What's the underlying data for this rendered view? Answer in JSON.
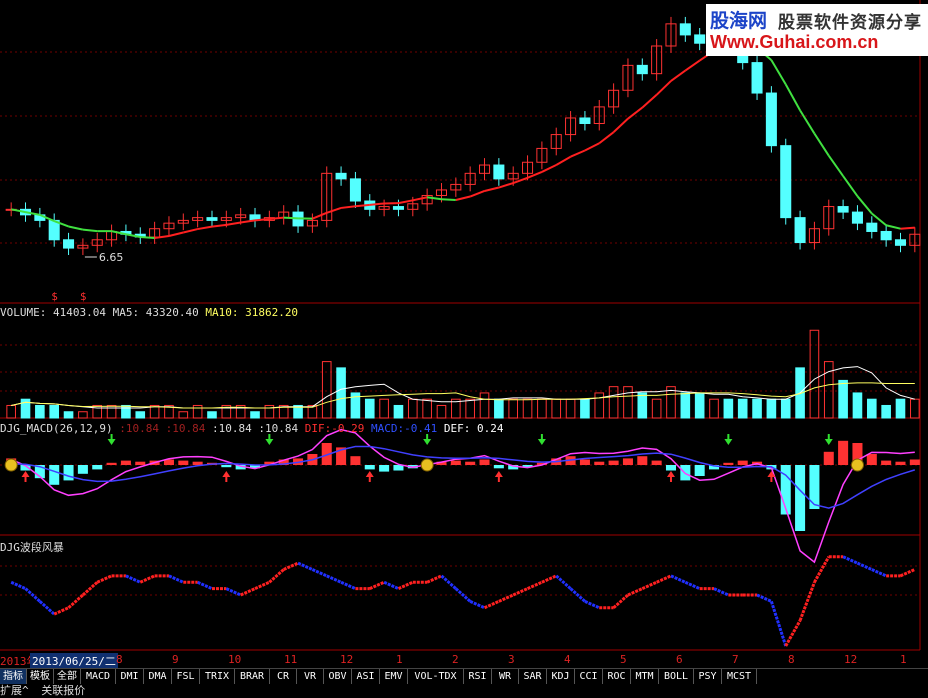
{
  "watermark": {
    "name": "股海网",
    "slogan": "股票软件资源分享",
    "url": "Www.Guhai.com.cn"
  },
  "panes": {
    "price": {
      "low_label": "6.65",
      "marker": "$"
    },
    "volume": {
      "label": "VOLUME:",
      "value": "41403.04",
      "ma5_label": "MA5:",
      "ma5": "43320.40",
      "ma10_label": "MA10:",
      "ma10": "31862.20"
    },
    "macd": {
      "label": "DJG_MACD(26,12,9)",
      "v1": ":10.84",
      "v2": ":10.84",
      "v3": ":10.84",
      "v4": ":10.84",
      "dif_label": "DIF:",
      "dif": "-0.29",
      "macd_label": "MACD:",
      "macd": "-0.41",
      "def_label": "DEF:",
      "def": "0.24"
    },
    "storm": {
      "label": "DJG波段风暴"
    }
  },
  "date_axis": {
    "start_year": "2013年",
    "cursor_date": "2013/06/25/二",
    "ticks": [
      "8",
      "9",
      "10",
      "11",
      "12",
      "1",
      "2",
      "3",
      "4",
      "5",
      "6",
      "7",
      "8",
      "12",
      "1"
    ]
  },
  "tabs": [
    "指标",
    "模板",
    "全部",
    "MACD",
    "DMI",
    "DMA",
    "FSL",
    "TRIX",
    "BRAR",
    "CR",
    "VR",
    "OBV",
    "ASI",
    "EMV",
    "VOL-TDX",
    "RSI",
    "WR",
    "SAR",
    "KDJ",
    "CCI",
    "ROC",
    "MTM",
    "BOLL",
    "PSY",
    "MCST"
  ],
  "status": {
    "expand": "扩展^",
    "quote": "关联报价"
  },
  "colors": {
    "up": "#ff3232",
    "down": "#54ffff",
    "ma_up": "#ff2020",
    "ma_down": "#40e040",
    "dif": "#ff40ff",
    "macd": "#4040ff",
    "grid": "#8b0000"
  },
  "chart_data": {
    "type": "candlestick",
    "subtype": "price with moving average, volume, MACD and oscillator sub-panes",
    "price": {
      "closes": [
        8.3,
        8.1,
        7.9,
        7.2,
        6.9,
        7.0,
        7.2,
        7.5,
        7.4,
        7.3,
        7.6,
        7.8,
        7.9,
        8.0,
        7.9,
        8.0,
        8.1,
        7.9,
        8.0,
        8.2,
        7.7,
        7.9,
        9.6,
        9.4,
        8.6,
        8.3,
        8.4,
        8.3,
        8.5,
        8.8,
        9.0,
        9.2,
        9.6,
        9.9,
        9.4,
        9.6,
        10.0,
        10.5,
        11.0,
        11.6,
        11.4,
        12.0,
        12.6,
        13.5,
        13.2,
        14.2,
        15.0,
        14.6,
        14.3,
        14.8,
        14.1,
        13.6,
        12.5,
        10.6,
        8.0,
        7.1,
        7.6,
        8.4,
        8.2,
        7.8,
        7.5,
        7.2,
        7.0,
        7.4
      ],
      "ma_up_segments": "red while rising",
      "ma_down_segments": "green while falling",
      "annotated_low": 6.65
    },
    "volume": {
      "values": [
        2,
        3,
        2,
        2,
        1,
        1,
        2,
        2,
        2,
        1,
        2,
        2,
        1,
        2,
        1,
        2,
        2,
        1,
        2,
        2,
        2,
        2,
        9,
        8,
        4,
        3,
        3,
        2,
        3,
        3,
        2,
        3,
        3,
        4,
        3,
        3,
        3,
        3,
        3,
        3,
        3,
        4,
        5,
        5,
        4,
        3,
        5,
        4,
        4,
        3,
        3,
        3,
        3,
        3,
        3,
        8,
        14,
        9,
        6,
        4,
        3,
        2,
        3,
        3
      ],
      "series": [
        {
          "name": "MA5",
          "value": 43320.4
        },
        {
          "name": "MA10",
          "value": 31862.2
        }
      ],
      "last": 41403.04
    },
    "macd": {
      "hist": [
        0.06,
        -0.05,
        -0.12,
        -0.18,
        -0.14,
        -0.08,
        -0.04,
        0.02,
        0.04,
        0.03,
        0.04,
        0.05,
        0.04,
        0.03,
        0.02,
        -0.02,
        -0.04,
        -0.03,
        0.03,
        0.05,
        0.06,
        0.1,
        0.2,
        0.16,
        0.08,
        -0.04,
        -0.06,
        -0.05,
        -0.03,
        0.02,
        0.03,
        0.04,
        0.03,
        0.05,
        -0.03,
        -0.04,
        -0.02,
        0.02,
        0.06,
        0.08,
        0.05,
        0.03,
        0.04,
        0.06,
        0.08,
        0.04,
        -0.05,
        -0.14,
        -0.1,
        -0.04,
        0.02,
        0.04,
        0.03,
        -0.04,
        -0.45,
        -0.6,
        -0.4,
        0.12,
        0.22,
        0.2,
        0.1,
        0.04,
        0.03,
        0.05
      ],
      "DIF": -0.29,
      "MACD": -0.41,
      "DEF": 0.24
    },
    "storm": {
      "values": [
        2,
        1,
        -1,
        -3,
        -2,
        0,
        2,
        3,
        3,
        2,
        3,
        3,
        2,
        2,
        1,
        1,
        0,
        1,
        2,
        4,
        5,
        4,
        3,
        2,
        1,
        1,
        2,
        1,
        2,
        2,
        3,
        1,
        -1,
        -2,
        -1,
        0,
        1,
        2,
        3,
        1,
        -1,
        -2,
        -2,
        0,
        1,
        2,
        3,
        2,
        1,
        1,
        0,
        0,
        0,
        -1,
        -8,
        -4,
        2,
        6,
        6,
        5,
        4,
        3,
        3,
        4
      ]
    }
  }
}
